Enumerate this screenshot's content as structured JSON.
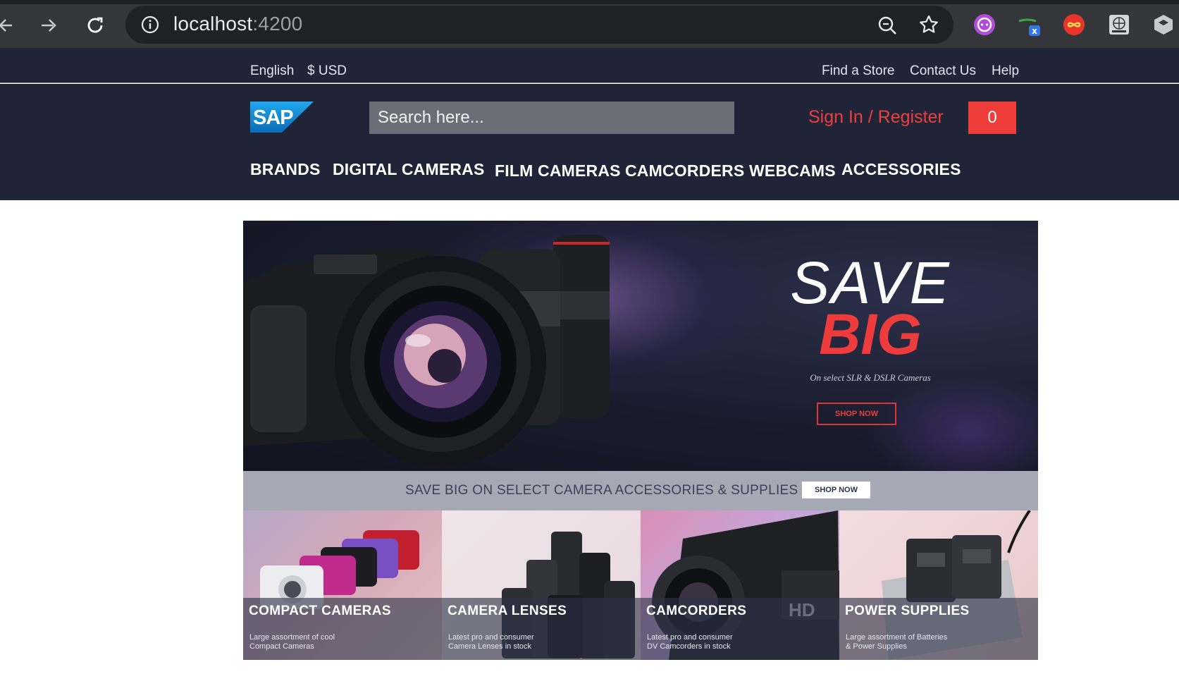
{
  "browser": {
    "url_host": "localhost",
    "url_port": ":4200",
    "icons": [
      "back-arrow-icon",
      "forward-arrow-icon",
      "reload-icon",
      "info-icon",
      "zoom-icon",
      "star-icon"
    ],
    "extensions": [
      "extension-purple-icon",
      "extension-glasses-icon",
      "extension-infinity-icon",
      "extension-globe-icon",
      "extension-layers-icon"
    ],
    "extension_badge": "x"
  },
  "topbar": {
    "language": "English",
    "currency": "$ USD",
    "links": [
      "Find a Store",
      "Contact Us",
      "Help"
    ]
  },
  "header": {
    "logo_text": "SAP",
    "search_placeholder": "Search here...",
    "signin_label": "Sign In / Register",
    "cart_count": "0",
    "menu": [
      "BRANDS",
      "DIGITAL CAMERAS",
      "FILM CAMERAS",
      "CAMCORDERS",
      "WEBCAMS",
      "ACCESSORIES"
    ]
  },
  "banner": {
    "headline_1": "SAVE",
    "headline_2": "BIG",
    "subtitle": "On select SLR & DSLR Cameras",
    "cta": "SHOP NOW"
  },
  "promo_strip": {
    "text": "SAVE BIG ON SELECT CAMERA ACCESSORIES & SUPPLIES",
    "cta": "SHOP NOW"
  },
  "categories": [
    {
      "title": "COMPACT CAMERAS",
      "desc_1": "Large assortment of cool",
      "desc_2": "Compact Cameras"
    },
    {
      "title": "CAMERA LENSES",
      "desc_1": "Latest pro and consumer",
      "desc_2": "Camera Lenses in stock"
    },
    {
      "title": "CAMCORDERS",
      "desc_1": "Latest pro and consumer",
      "desc_2": "DV Camcorders in stock"
    },
    {
      "title": "POWER SUPPLIES",
      "desc_1": "Large assortment of Batteries",
      "desc_2": "& Power Supplies"
    }
  ],
  "colors": {
    "header_bg": "#1f2537",
    "accent_red": "#ef3e3a",
    "strip_bg": "#a6a9b3"
  }
}
